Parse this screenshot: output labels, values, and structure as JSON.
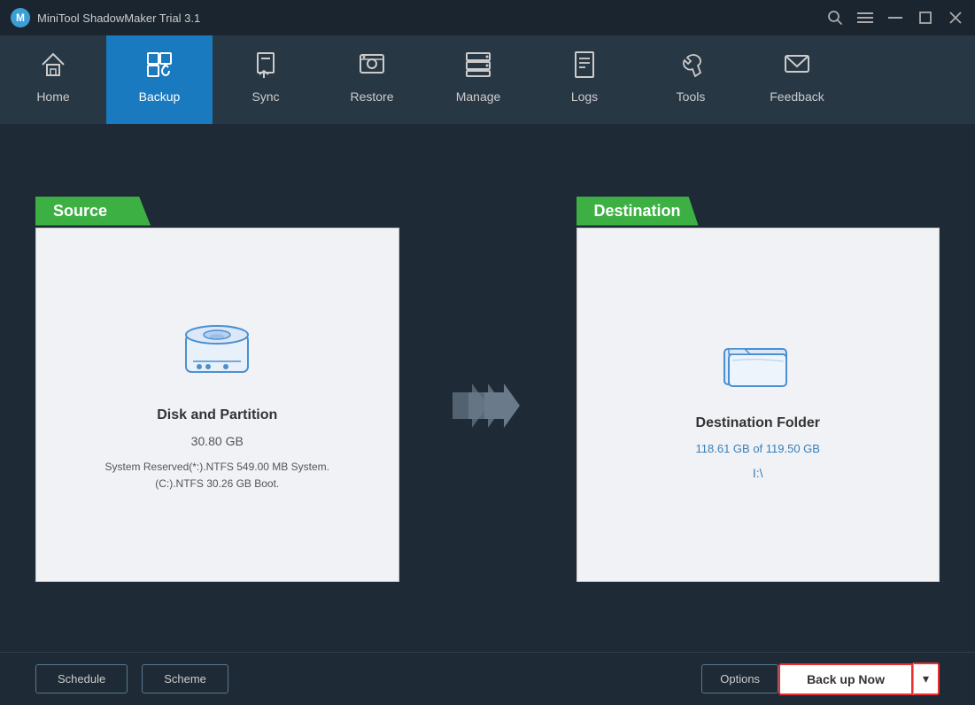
{
  "titleBar": {
    "appName": "MiniTool ShadowMaker Trial 3.1",
    "controls": {
      "search": "🔍",
      "menu": "☰",
      "minimize": "—",
      "maximize": "□",
      "close": "✕"
    }
  },
  "nav": {
    "items": [
      {
        "id": "home",
        "label": "Home",
        "icon": "🏠",
        "active": false
      },
      {
        "id": "backup",
        "label": "Backup",
        "icon": "💾",
        "active": true
      },
      {
        "id": "sync",
        "label": "Sync",
        "icon": "🔄",
        "active": false
      },
      {
        "id": "restore",
        "label": "Restore",
        "icon": "🖥",
        "active": false
      },
      {
        "id": "manage",
        "label": "Manage",
        "icon": "⚙",
        "active": false
      },
      {
        "id": "logs",
        "label": "Logs",
        "icon": "📋",
        "active": false
      },
      {
        "id": "tools",
        "label": "Tools",
        "icon": "🔧",
        "active": false
      },
      {
        "id": "feedback",
        "label": "Feedback",
        "icon": "✉",
        "active": false
      }
    ]
  },
  "source": {
    "title": "Source",
    "iconAlt": "disk-icon",
    "label": "Disk and Partition",
    "size": "30.80 GB",
    "detail": "System Reserved(*:).NTFS 549.00 MB System.\n(C:).NTFS 30.26 GB Boot."
  },
  "destination": {
    "title": "Destination",
    "iconAlt": "folder-icon",
    "label": "Destination Folder",
    "storage": "118.61 GB of 119.50 GB",
    "path": "I:\\"
  },
  "bottomBar": {
    "scheduleLabel": "Schedule",
    "schemeLabel": "Scheme",
    "optionsLabel": "Options",
    "backupNowLabel": "Back up Now",
    "dropdownArrow": "▾"
  }
}
